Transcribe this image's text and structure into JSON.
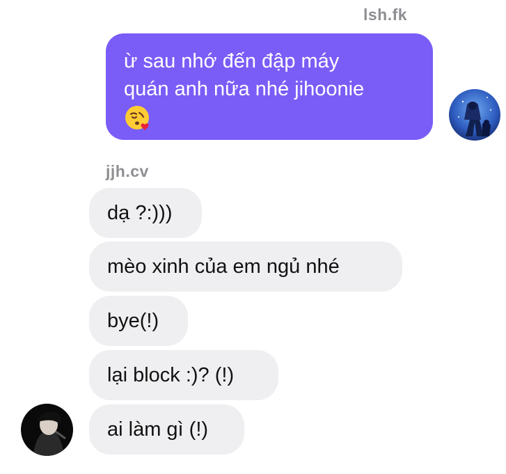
{
  "outgoing": {
    "sender": "lsh.fk",
    "message": {
      "line1": "ừ sau nhớ đến đập máy",
      "line2": "quán anh nữa nhé jihoonie",
      "emoji": "face-blowing-kiss-emoji"
    }
  },
  "incoming": {
    "sender": "jjh.cv",
    "messages": [
      "dạ ?:)))",
      "mèo xinh của em ngủ nhé",
      "bye(!)",
      "lại block :)? (!)",
      "ai làm gì (!)"
    ]
  },
  "colors": {
    "outgoing_bubble": "#7a5cf7",
    "incoming_bubble": "#efeff1",
    "sender_name": "#8e8e93"
  }
}
